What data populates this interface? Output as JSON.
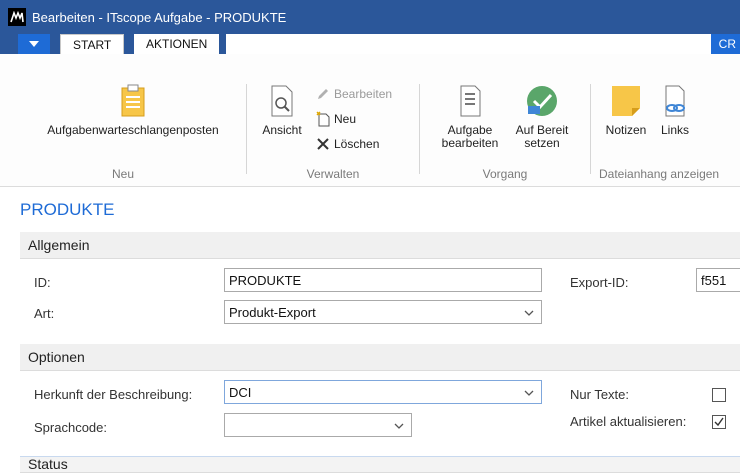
{
  "window": {
    "title": "Bearbeiten - ITscope Aufgabe - PRODUKTE"
  },
  "tabs": {
    "start": "START",
    "aktionen": "AKTIONEN",
    "right_label": "CR"
  },
  "ribbon": {
    "neu": {
      "button": "Aufgabenwarteschlangenposten",
      "group": "Neu"
    },
    "verwalten": {
      "ansicht": "Ansicht",
      "bearbeiten": "Bearbeiten",
      "neu": "Neu",
      "loeschen": "Löschen",
      "group": "Verwalten"
    },
    "vorgang": {
      "aufgabe_line1": "Aufgabe",
      "aufgabe_line2": "bearbeiten",
      "bereit_line1": "Auf Bereit",
      "bereit_line2": "setzen",
      "group": "Vorgang"
    },
    "dateianhang": {
      "notizen": "Notizen",
      "links": "Links",
      "group": "Dateianhang anzeigen"
    }
  },
  "page": {
    "title": "PRODUKTE"
  },
  "allgemein": {
    "header": "Allgemein",
    "id_label": "ID:",
    "id_value": "PRODUKTE",
    "art_label": "Art:",
    "art_value": "Produkt-Export",
    "export_label": "Export-ID:",
    "export_value": "f551"
  },
  "optionen": {
    "header": "Optionen",
    "herkunft_label": "Herkunft der Beschreibung:",
    "herkunft_value": "DCI",
    "sprach_label": "Sprachcode:",
    "sprach_value": "",
    "nur_texte_label": "Nur Texte:",
    "nur_texte_checked": false,
    "artikel_label": "Artikel aktualisieren:",
    "artikel_checked": true
  },
  "status": {
    "header": "Status"
  },
  "colors": {
    "accent": "#2b579a",
    "tab_blue": "#1e6bd6",
    "title_blue": "#1e6bd6"
  }
}
